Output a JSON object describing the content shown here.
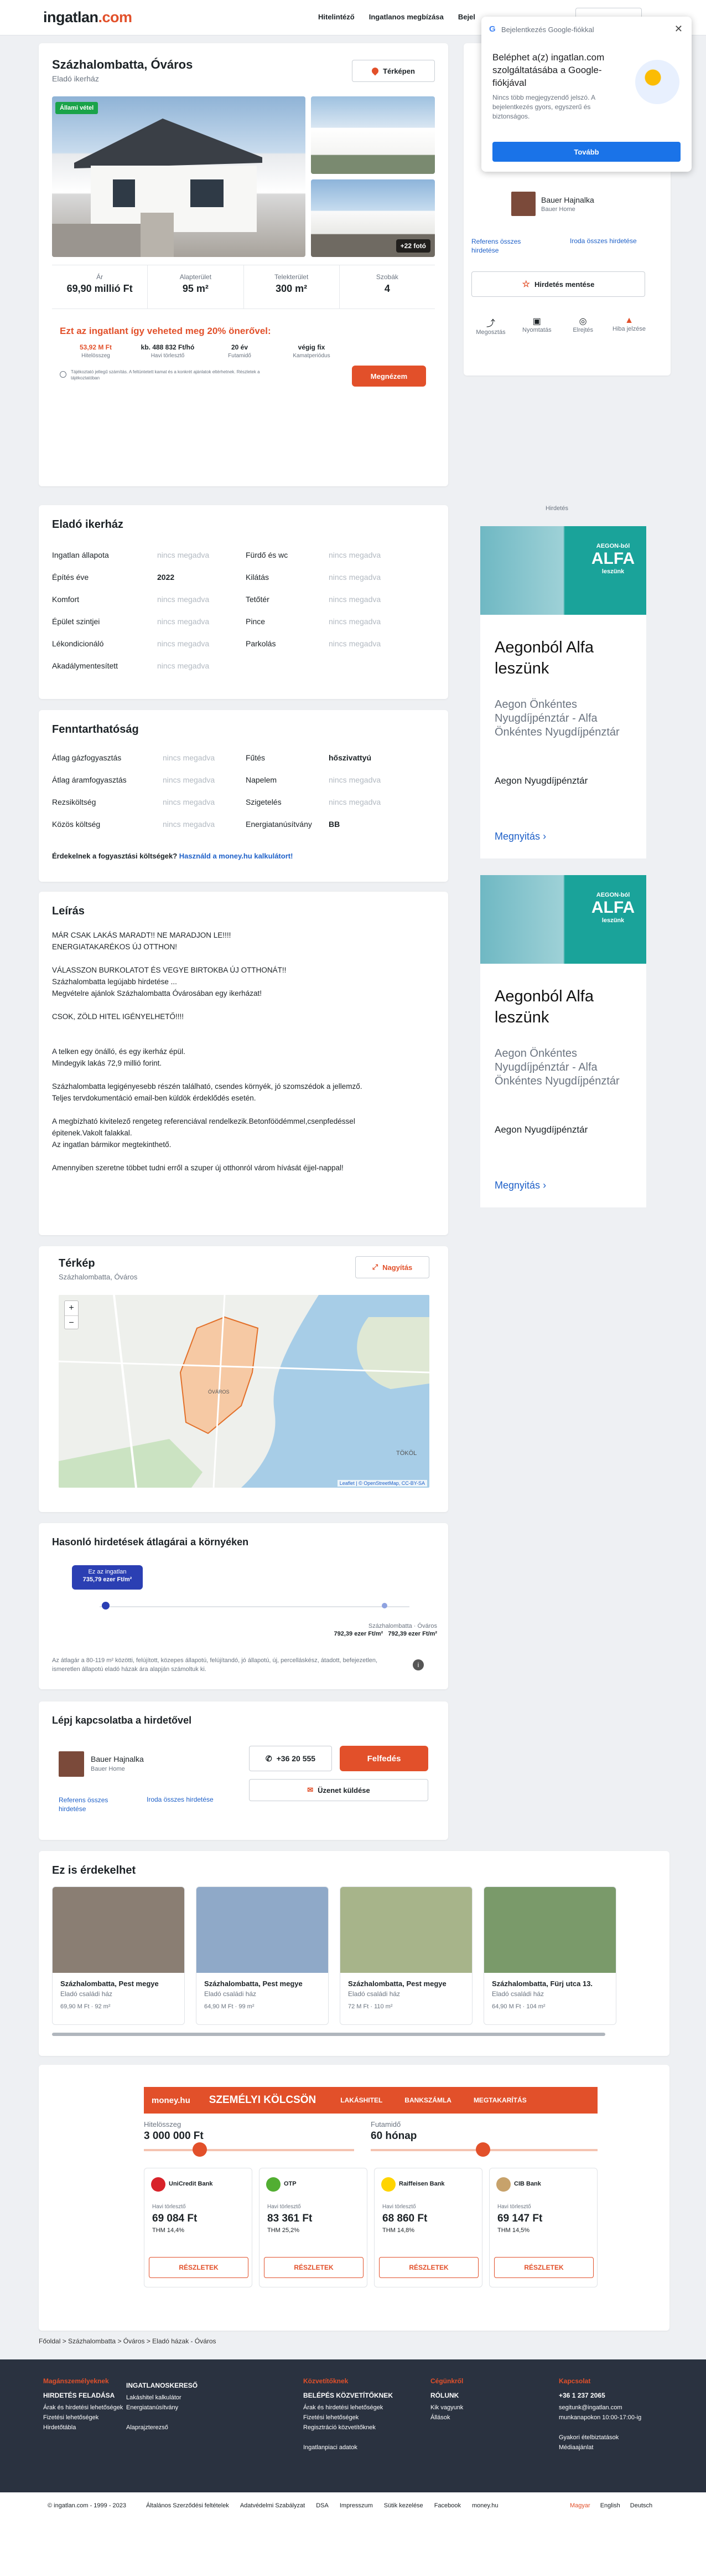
{
  "header": {
    "logo_main": "ingatlan",
    "logo_tld": ".com",
    "nav": [
      "Hitelintéző",
      "Ingatlanos megbízása",
      "Bejel"
    ]
  },
  "google": {
    "title_small": "Bejelentkezés Google-fiókkal",
    "heading": "Beléphet a(z) ingatlan.com szolgáltatásába a Google-fiókjával",
    "body": "Nincs több megjegyzendő jelszó. A bejelentkezés gyors, egyszerű és biztonságos.",
    "continue": "Tovább"
  },
  "listing": {
    "city": "Százhalombatta, Óváros",
    "type": "Eladó ikerház",
    "map_btn": "Térképen",
    "badge": "Állami vétel",
    "more_photos": "+22 fotó",
    "stats": [
      {
        "label": "Ár",
        "value": "69,90 millió Ft"
      },
      {
        "label": "Alapterület",
        "value": "95 m²"
      },
      {
        "label": "Telekterület",
        "value": "300 m²"
      },
      {
        "label": "Szobák",
        "value": "4"
      }
    ],
    "promo": "Ezt az ingatlant így veheted meg 20% önerővel:",
    "loan": [
      {
        "v": "53,92 M Ft",
        "l": "Hitelösszeg"
      },
      {
        "v": "kb. 488 832 Ft/hó",
        "l": "Havi törlesztő"
      },
      {
        "v": "20 év",
        "l": "Futamidő"
      },
      {
        "v": "végig fix",
        "l": "Kamatperiódus"
      }
    ],
    "loan_note": "Tájékoztató jellegű számítás. A feltüntetett kamat és a konkrét ajánlatok eltérhetnek. Részletek a tájékoztatóban",
    "loan_btn": "Megnézem"
  },
  "agent": {
    "name": "Bauer Hajnalka",
    "company": "Bauer Home",
    "link1": "Referens összes hirdetése",
    "link2": "Iroda összes hirdetése",
    "save": "Hirdetés mentése",
    "actions": [
      "Megosztás",
      "Nyomtatás",
      "Elrejtés",
      "Hiba jelzése"
    ]
  },
  "details": {
    "title": "Eladó ikerház",
    "left": [
      {
        "k": "Ingatlan állapota",
        "v": "nincs megadva"
      },
      {
        "k": "Építés éve",
        "v": "2022"
      },
      {
        "k": "Komfort",
        "v": "nincs megadva"
      },
      {
        "k": "Épület szintjei",
        "v": "nincs megadva"
      },
      {
        "k": "Lékondicionáló",
        "v": "nincs megadva"
      },
      {
        "k": "Akadálymentesített",
        "v": "nincs megadva"
      }
    ],
    "right": [
      {
        "k": "Fürdő és wc",
        "v": "nincs megadva"
      },
      {
        "k": "Kilátás",
        "v": "nincs megadva"
      },
      {
        "k": "Tetőtér",
        "v": "nincs megadva"
      },
      {
        "k": "Pince",
        "v": "nincs megadva"
      },
      {
        "k": "Parkolás",
        "v": "nincs megadva"
      }
    ]
  },
  "costs": {
    "title": "Fenntarthatóság",
    "left": [
      {
        "k": "Átlag gázfogyasztás",
        "v": "nincs megadva"
      },
      {
        "k": "Átlag áramfogyasztás",
        "v": "nincs megadva"
      },
      {
        "k": "Rezsiköltség",
        "v": "nincs megadva"
      },
      {
        "k": "Közös költség",
        "v": "nincs megadva"
      }
    ],
    "right": [
      {
        "k": "Fűtés",
        "v": "hőszivattyú"
      },
      {
        "k": "Napelem",
        "v": "nincs megadva"
      },
      {
        "k": "Szigetelés",
        "v": "nincs megadva"
      },
      {
        "k": "Energiatanúsítvány",
        "v": "BB"
      }
    ],
    "q": "Érdekelnek a fogyasztási költségek?",
    "link": "Használd a money.hu kalkulátort!"
  },
  "desc": {
    "title": "Leírás",
    "lines": [
      "MÁR CSAK LAKÁS MARADT!! NE MARADJON LE!!!!",
      "ENERGIATAKARÉKOS ÚJ OTTHON!",
      "",
      "VÁLASSZON BURKOLATOT ÉS VEGYE BIRTOKBA ÚJ OTTHONÁT!!",
      "Százhalombatta legújabb hirdetése ...",
      "Megvételre ajánlok Százhalombatta Óvárosában egy ikerházat!",
      "",
      "CSOK, ZÖLD HITEL IGÉNYELHETŐ!!!!",
      "",
      "",
      "A telken egy önálló, és egy ikerház épül.",
      "Mindegyik lakás 72,9 millió forint.",
      "",
      "Százhalombatta legigényesebb részén található, csendes környék, jó szomszédok a jellemző.",
      "Teljes tervdokumentáció email-ben küldök érdeklődés esetén.",
      "",
      "A megbízható kivitelező rengeteg referenciával rendelkezik.Betonföödémmel,csenpfedéssel",
      "épitenek.Vakolt falakkal.",
      "Az ingatlan bármikor megtekinthető.",
      "",
      "Amennyiben szeretne többet tudni erről a szuper új otthonról várom hívását éjjel-nappal!"
    ]
  },
  "map": {
    "title": "Térkép",
    "sub": "Százhalombatta, Óváros",
    "enlarge": "Nagyítás",
    "label_area": "ÓVÁROS",
    "label_town": "TÖKÖL",
    "attrib": "Leaflet | © OpenStreetMap, CC-BY-SA"
  },
  "avg": {
    "title": "Hasonló hirdetések átlagárai a környéken",
    "this_label": "Ez az ingatlan",
    "this_value": "735,79 ezer Ft/m²",
    "area_label": "Százhalombatta · Óváros",
    "area_value1": "792,39 ezer Ft/m²",
    "area_value2": "792,39 ezer Ft/m²",
    "note": "Az átlagár a 80-119 m² közötti, felújított, közepes állapotú, felújítandó, jó állapotú, új, percelláskész, átadott, befejezetlen, ismeretlen állapotú eladó házak ára alapján számoltuk ki."
  },
  "contact": {
    "title": "Lépj kapcsolatba a hirdetővel",
    "phone": "+36 20 555",
    "reveal": "Felfedés",
    "message": "Üzenet küldése"
  },
  "similar": {
    "title": "Ez is érdekelhet",
    "items": [
      {
        "loc": "Százhalombatta, Pest megye",
        "type": "Eladó családi ház",
        "price": "69,90 M Ft",
        "area": "92 m²"
      },
      {
        "loc": "Százhalombatta, Pest megye",
        "type": "Eladó családi ház",
        "price": "64,90 M Ft",
        "area": "99 m²"
      },
      {
        "loc": "Százhalombatta, Pest megye",
        "type": "Eladó családi ház",
        "price": "72 M Ft",
        "area": "110 m²"
      },
      {
        "loc": "Százhalombatta, Fürj utca 13.",
        "type": "Eladó családi ház",
        "price": "64,90 M Ft",
        "area": "104 m²"
      }
    ]
  },
  "money": {
    "brand": "money.hu",
    "product": "SZEMÉLYI KÖLCSÖN",
    "tabs": [
      "LAKÁSHITEL",
      "BANKSZÁMLA",
      "MEGTAKARÍTÁS"
    ],
    "amount_label": "Hitelösszeg",
    "amount": "3 000 000 Ft",
    "term_label": "Futamidő",
    "term": "60 hónap",
    "banks": [
      {
        "name": "UniCredit Bank",
        "rate_label": "Havi törlesztő",
        "rate": "69 084 Ft",
        "thm": "THM 14,4%",
        "btn": "RÉSZLETEK"
      },
      {
        "name": "OTP",
        "rate_label": "Havi törlesztő",
        "rate": "83 361 Ft",
        "thm": "THM 25,2%",
        "btn": "RÉSZLETEK"
      },
      {
        "name": "Raiffeisen Bank",
        "rate_label": "Havi törlesztő",
        "rate": "68 860 Ft",
        "thm": "THM 14,8%",
        "btn": "RÉSZLETEK"
      },
      {
        "name": "CIB Bank",
        "rate_label": "Havi törlesztő",
        "rate": "69 147 Ft",
        "thm": "THM 14,5%",
        "btn": "RÉSZLETEK"
      }
    ]
  },
  "ads": {
    "label": "Hirdetés",
    "title": "Aegonból Alfa leszünk",
    "text": "Aegon Önkéntes Nyugdíjpénztár - Alfa Önkéntes Nyugdíjpénztár",
    "brand": "Aegon Nyugdíjpénztár",
    "open": "Megnyitás",
    "banner_line1": "AEGON-ból",
    "banner_line2": "ALFA",
    "banner_line3": "leszünk"
  },
  "breadcrumb": [
    "Főoldal",
    "Százhalombatta",
    "Óváros",
    "Eladó házak - Óváros"
  ],
  "footer": {
    "cols": [
      {
        "t": "Magánszemélyeknek",
        "s": "HIRDETÉS FELADÁSA",
        "items": [
          "Árak és hirdetési lehetőségek",
          "Fizetési lehetőségek",
          "Hirdetőtábla"
        ]
      },
      {
        "t": "",
        "s": "INGATLANOSKERESŐ",
        "items": [
          "Lakáshitel kalkulátor",
          "Energiatanúsítvány",
          "",
          "Alaprajzterezső"
        ]
      },
      {
        "t": "Közvetítőknek",
        "s": "BELÉPÉS KÖZVETÍTŐKNEK",
        "items": [
          "Árak és hirdetési lehetőségek",
          "Fizetési lehetőségek",
          "Regisztráció közvetítőknek",
          "",
          "Ingatlanpiaci adatok"
        ]
      },
      {
        "t": "Cégünkről",
        "s": "RÓLUNK",
        "items": [
          "Kik vagyunk",
          "Állások"
        ]
      },
      {
        "t": "Kapcsolat",
        "s": "+36 1 237 2065",
        "items": [
          "segitunk@ingatlan.com",
          "munkanapokon 10:00-17:00-ig",
          "",
          "Gyakori ételbiztatások",
          "Médiaajánlat"
        ]
      }
    ]
  },
  "bottom": {
    "copy": "© ingatlan.com - 1999 - 2023",
    "links": [
      "Általános Szerződési feltételek",
      "Adatvédelmi Szabályzat",
      "DSA",
      "Impresszum",
      "Sütik kezelése",
      "Facebook",
      "money.hu"
    ],
    "langs": [
      "Magyar",
      "English",
      "Deutsch"
    ]
  }
}
